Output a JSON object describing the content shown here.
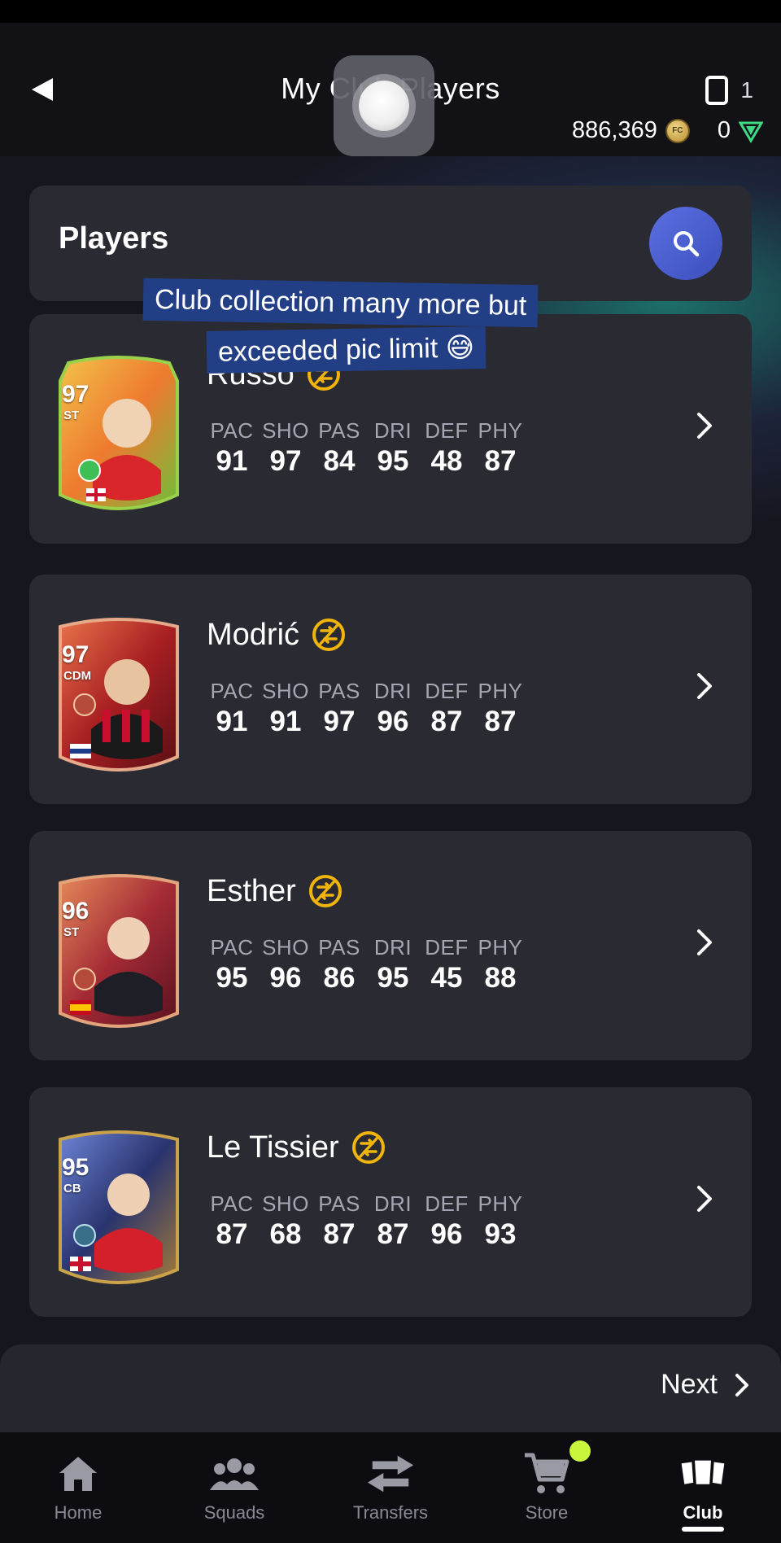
{
  "header": {
    "title": "My Club Players",
    "notification_count": "1",
    "coins": "886,369",
    "points": "0"
  },
  "panel": {
    "title": "Players"
  },
  "caption": {
    "line1": "Club collection many more but",
    "line2": "exceeded pic limit 😅"
  },
  "players": [
    {
      "name": "Russo",
      "rating": "97",
      "position": "ST",
      "stats": [
        {
          "label": "PAC",
          "value": "91"
        },
        {
          "label": "SHO",
          "value": "97"
        },
        {
          "label": "PAS",
          "value": "84"
        },
        {
          "label": "DRI",
          "value": "95"
        },
        {
          "label": "DEF",
          "value": "48"
        },
        {
          "label": "PHY",
          "value": "87"
        }
      ],
      "card_colors": [
        "#7ac943",
        "#f2a23a",
        "#e8532b"
      ]
    },
    {
      "name": "Modrić",
      "rating": "97",
      "position": "CDM",
      "stats": [
        {
          "label": "PAC",
          "value": "91"
        },
        {
          "label": "SHO",
          "value": "91"
        },
        {
          "label": "PAS",
          "value": "97"
        },
        {
          "label": "DRI",
          "value": "96"
        },
        {
          "label": "DEF",
          "value": "87"
        },
        {
          "label": "PHY",
          "value": "87"
        }
      ],
      "card_colors": [
        "#8b1a1a",
        "#c0392b",
        "#e67e22"
      ]
    },
    {
      "name": "Esther",
      "rating": "96",
      "position": "ST",
      "stats": [
        {
          "label": "PAC",
          "value": "95"
        },
        {
          "label": "SHO",
          "value": "96"
        },
        {
          "label": "PAS",
          "value": "86"
        },
        {
          "label": "DRI",
          "value": "95"
        },
        {
          "label": "DEF",
          "value": "45"
        },
        {
          "label": "PHY",
          "value": "88"
        }
      ],
      "card_colors": [
        "#7d1f2a",
        "#b83a3a",
        "#e0884a"
      ]
    },
    {
      "name": "Le Tissier",
      "rating": "95",
      "position": "CB",
      "stats": [
        {
          "label": "PAC",
          "value": "87"
        },
        {
          "label": "SHO",
          "value": "68"
        },
        {
          "label": "PAS",
          "value": "87"
        },
        {
          "label": "DRI",
          "value": "87"
        },
        {
          "label": "DEF",
          "value": "96"
        },
        {
          "label": "PHY",
          "value": "93"
        }
      ],
      "card_colors": [
        "#1c2a5a",
        "#3a4a9a",
        "#c9a24a"
      ]
    }
  ],
  "pagination": {
    "next_label": "Next"
  },
  "nav": {
    "items": [
      {
        "label": "Home",
        "icon": "home-icon"
      },
      {
        "label": "Squads",
        "icon": "squads-icon"
      },
      {
        "label": "Transfers",
        "icon": "transfers-icon"
      },
      {
        "label": "Store",
        "icon": "store-icon"
      },
      {
        "label": "Club",
        "icon": "club-icon"
      }
    ],
    "active": "Club"
  },
  "colors": {
    "background": "#16161e",
    "panel": "#2a2a33",
    "accent_blue": "#4f63d6",
    "coin_gold": "#d6b14a",
    "untradeable_gold": "#f0b40a",
    "store_dot": "#c9f53d"
  }
}
